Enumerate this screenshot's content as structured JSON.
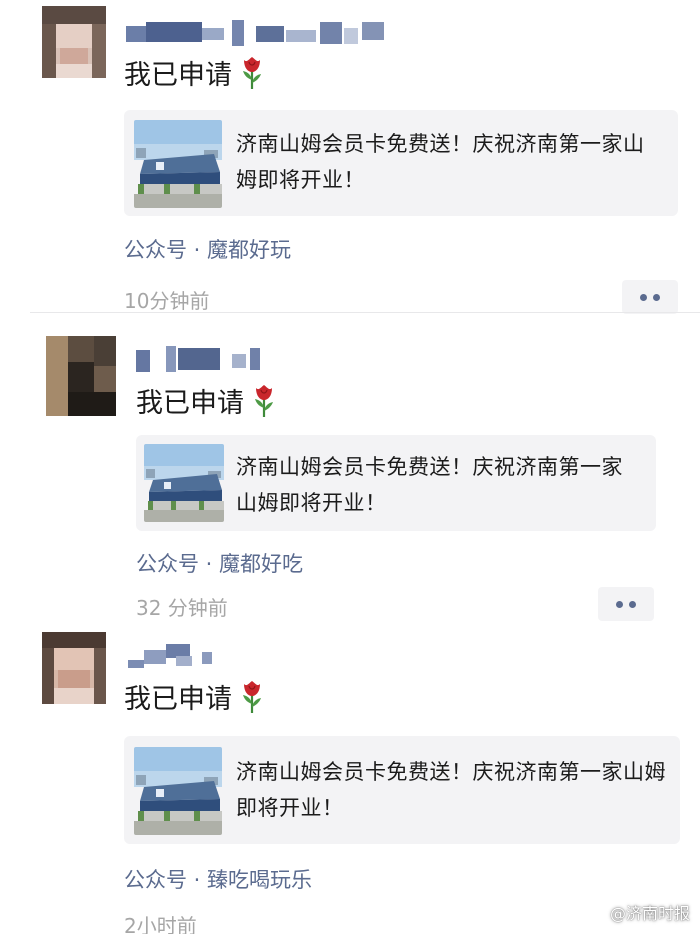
{
  "posts": [
    {
      "message": "我已申请",
      "card_text": "济南山姆会员卡免费送！庆祝济南第一家山姆即将开业！",
      "source": "公众号 · 魔都好玩",
      "time": "10分钟前"
    },
    {
      "message": "我已申请",
      "card_text": "济南山姆会员卡免费送！庆祝济南第一家山姆即将开业！",
      "source": "公众号 · 魔都好吃",
      "time": "32 分钟前"
    },
    {
      "message": "我已申请",
      "card_text": "济南山姆会员卡免费送！庆祝济南第一家山姆即将开业！",
      "source": "公众号 · 臻吃喝玩乐",
      "time": "2小时前"
    }
  ],
  "icons": {
    "rose": "rose-emoji-icon",
    "more": "more-dots-icon",
    "thumbnail": "sams-club-store-thumbnail"
  },
  "watermark": "@济南时报",
  "colors": {
    "link": "#5b6b8f",
    "time": "#a6a6a6",
    "card_bg": "#f3f3f5",
    "rose": "#c9262c"
  }
}
